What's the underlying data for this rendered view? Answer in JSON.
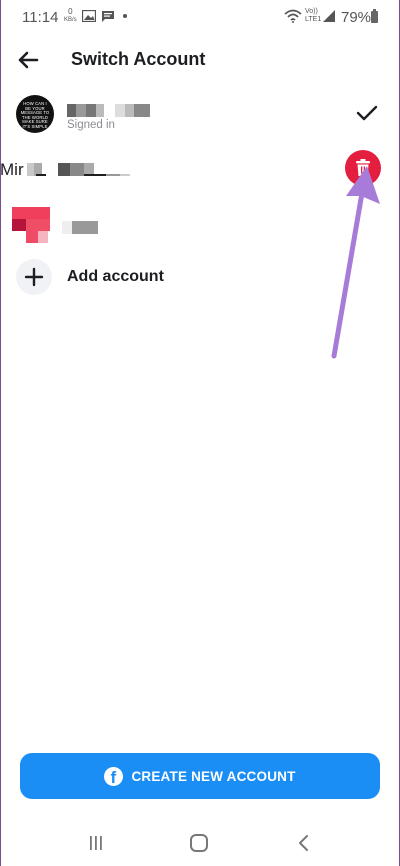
{
  "status_bar": {
    "time": "11:14",
    "net_speed_value": "0",
    "net_speed_unit": "KB/s",
    "network_label_1": "Vo))",
    "network_label_2": "LTE1",
    "battery": "79%"
  },
  "header": {
    "title": "Switch Account"
  },
  "accounts": [
    {
      "avatar_text": "HOW CAN I BE YOUR MESSAGE TO THE WORLD MAKE SURE IT'S SIMPLE",
      "status": "Signed in"
    },
    {
      "name_visible": "Mir"
    },
    {}
  ],
  "add_account": {
    "label": "Add account"
  },
  "create_button": {
    "label": "CREATE NEW ACCOUNT",
    "icon_letter": "f"
  },
  "colors": {
    "accent": "#1b8ef5",
    "delete": "#e41e3f",
    "annotation_arrow": "#a77bd8"
  }
}
